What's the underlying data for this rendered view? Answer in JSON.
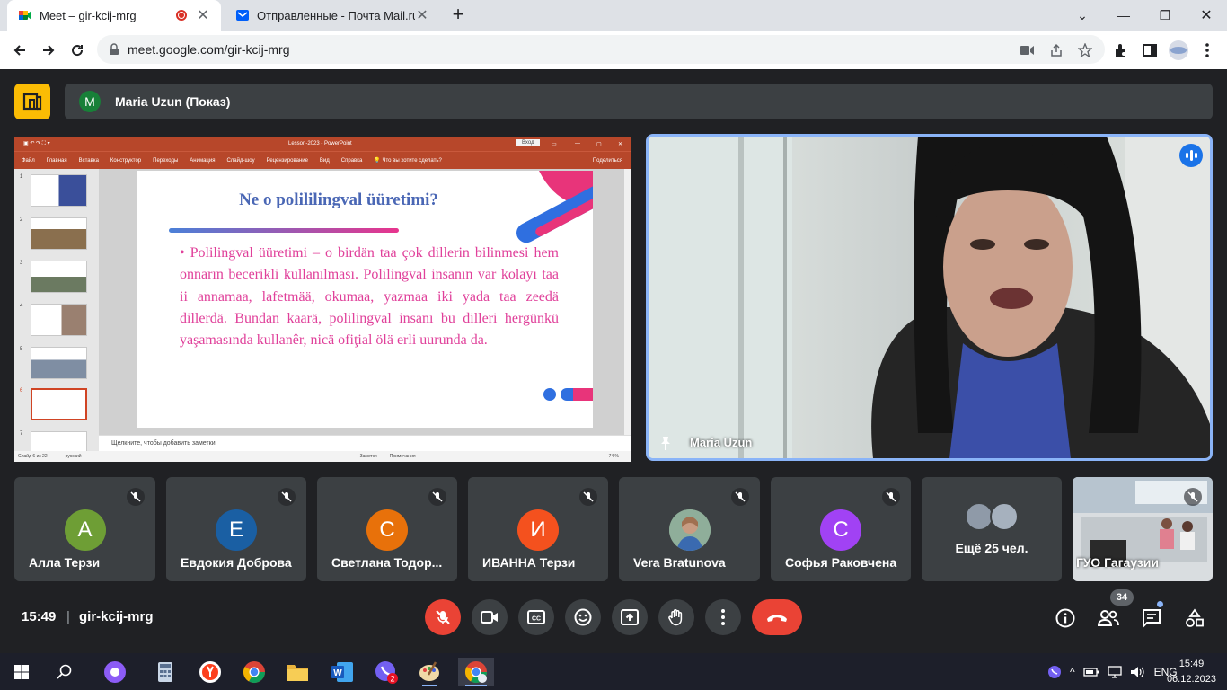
{
  "browser": {
    "tabs": [
      {
        "title": "Meet – gir-kcij-mrg",
        "active": true,
        "recording": true
      },
      {
        "title": "Отправленные - Почта Mail.ru",
        "active": false
      }
    ],
    "url": "meet.google.com/gir-kcij-mrg"
  },
  "presentation": {
    "presenter_initial": "M",
    "presenter_label": "Maria Uzun (Показ)"
  },
  "powerpoint": {
    "window_title": "Lesson-2023 - PowerPoint",
    "login_label": "Вход",
    "ribbon": [
      "Файл",
      "Главная",
      "Вставка",
      "Конструктор",
      "Переходы",
      "Анимация",
      "Слайд-шоу",
      "Рецензирование",
      "Вид",
      "Справка",
      "Что вы хотите сделать?",
      "Поделиться"
    ],
    "thumb_numbers": [
      "1",
      "2",
      "3",
      "4",
      "5",
      "6",
      "7"
    ],
    "selected_thumb": 6,
    "notes_placeholder": "Щелкните, чтобы добавить заметки",
    "status": {
      "slide": "Слайд 6 из 22",
      "lang": "русский",
      "notes": "Заметки",
      "comments": "Примечания",
      "zoom": "74 %"
    },
    "slide": {
      "title": "Ne o polililingval üüretimi?",
      "body": "• Polilingval üüretimi – o birdän taa çok dillerin bilinmesi hem onnarın becerikli kullanılması. Polilingval insanın var kolayı taa ii annamaa, lafetmää, okumaa, yazmaa iki yada taa zeedä dillerdä. Bundan kaarä, polilingval insanı bu dilleri hergünkü yaşamasında kullanêr, nicä ofiţial ölä erli uurunda da."
    }
  },
  "speaker": {
    "name": "Maria Uzun"
  },
  "participants": [
    {
      "initial": "А",
      "name": "Алла Терзи",
      "color": "#6e9e35"
    },
    {
      "initial": "Е",
      "name": "Евдокия Доброва",
      "color": "#1a5fa3"
    },
    {
      "initial": "С",
      "name": "Светлана Тодор...",
      "color": "#e8710a"
    },
    {
      "initial": "И",
      "name": "ИВАННА Терзи",
      "color": "#f4511e"
    },
    {
      "initial": "",
      "name": "Vera Bratunova",
      "color": "#7a9e7e"
    },
    {
      "initial": "С",
      "name": "Софья Раковчена",
      "color": "#a142f4"
    }
  ],
  "more_participants": "Ещё 25 чел.",
  "room_tile": {
    "name": "ГУО Гагаузии"
  },
  "meeting": {
    "time": "15:49",
    "separator": "|",
    "code": "gir-kcij-mrg",
    "people_count": "34"
  },
  "taskbar": {
    "lang": "ENG",
    "time": "15:49",
    "date": "06.12.2023",
    "viber_badge": "2"
  },
  "colors": {
    "accent": "#8ab4f8",
    "danger": "#ea4335",
    "bg": "#202124",
    "tile": "#3c4043"
  }
}
